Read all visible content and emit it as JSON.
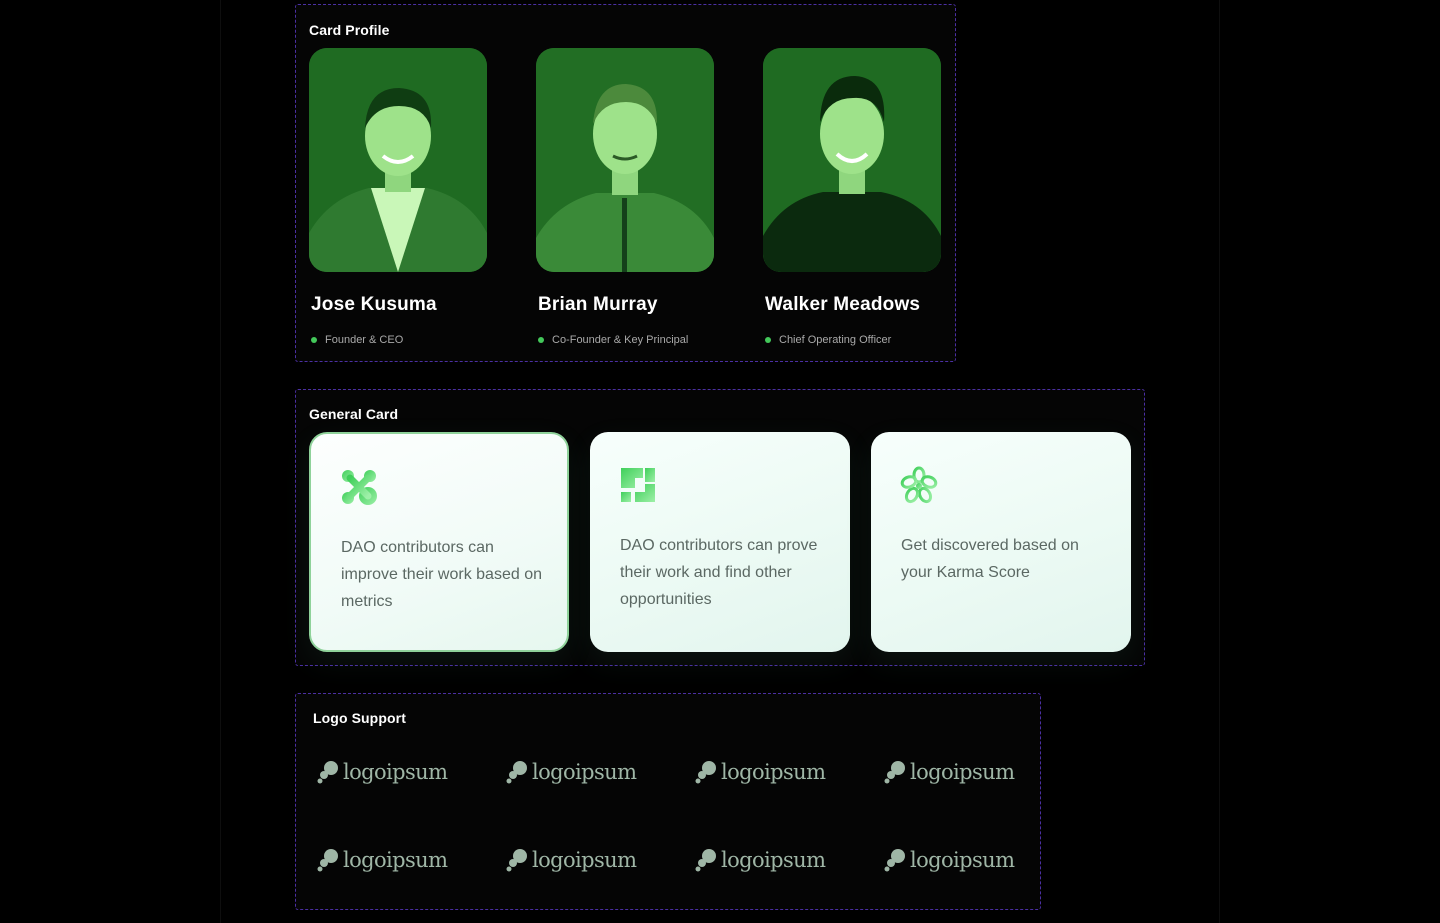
{
  "profile_section": {
    "title": "Card Profile",
    "people": [
      {
        "name": "Jose Kusuma",
        "role": "Founder & CEO"
      },
      {
        "name": "Brian Murray",
        "role": "Co-Founder & Key Principal"
      },
      {
        "name": "Walker Meadows",
        "role": "Chief Operating Officer"
      }
    ]
  },
  "general_section": {
    "title": "General Card",
    "cards": [
      {
        "icon": "x-blob-icon",
        "text": "DAO contributors can improve their work based on metrics"
      },
      {
        "icon": "puzzle-square-icon",
        "text": "DAO contributors can prove their work and find other opportunities"
      },
      {
        "icon": "flower-icon",
        "text": "Get discovered based on your Karma Score"
      }
    ]
  },
  "logo_section": {
    "title": "Logo Support",
    "logos": [
      "logoipsum",
      "logoipsum",
      "logoipsum",
      "logoipsum",
      "logoipsum",
      "logoipsum",
      "logoipsum",
      "logoipsum"
    ]
  },
  "colors": {
    "background": "#000000",
    "section_border": "#4b2fa3",
    "photo_green": "#1f6b22",
    "status_dot": "#43c85a",
    "logo_text": "#9fb6a6"
  }
}
